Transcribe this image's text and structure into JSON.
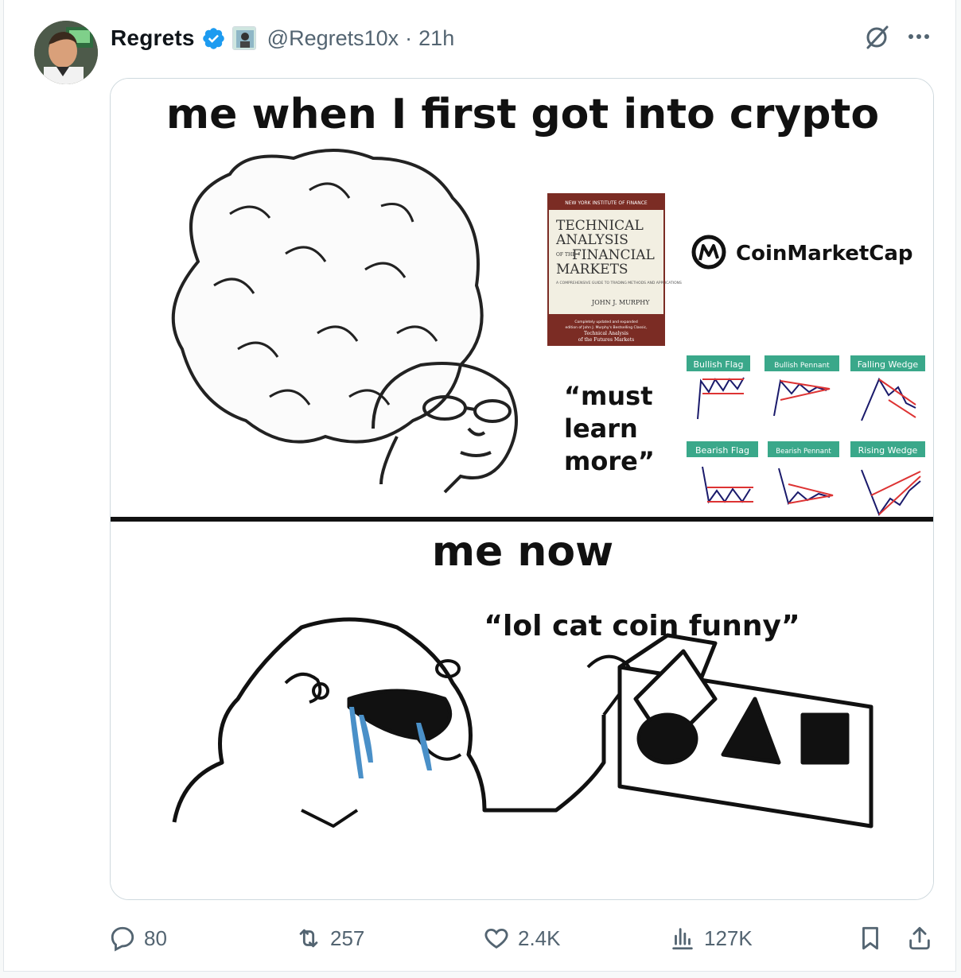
{
  "tweet": {
    "author_name": "Regrets",
    "handle": "@Regrets10x",
    "separator": "·",
    "time": "21h",
    "icons": {
      "verified": "verified-badge-icon",
      "affiliate": "affiliate-badge-icon",
      "grok": "grok-icon",
      "more": "more-icon"
    }
  },
  "meme": {
    "top_caption": "me when I first got into crypto",
    "book": {
      "publisher": "NEW YORK INSTITUTE OF FINANCE",
      "title_line1": "TECHNICAL",
      "title_line2": "ANALYSIS",
      "title_line3_small": "OF THE",
      "title_line3": "FINANCIAL",
      "title_line4": "MARKETS",
      "subtitle": "A COMPREHENSIVE GUIDE TO TRADING METHODS AND APPLICATIONS",
      "author": "JOHN J. MURPHY",
      "footer1": "Completely updated and expanded",
      "footer2": "edition of John J. Murphy's Bestselling Classic,",
      "footer3": "Technical Analysis",
      "footer4": "of the Futures Markets"
    },
    "coinmarketcap": "CoinMarketCap",
    "quote_line1": "“must",
    "quote_line2": "learn",
    "quote_line3": "more”",
    "patterns": [
      "Bullish Flag",
      "Bullish Pennant",
      "Falling Wedge",
      "Bearish Flag",
      "Bearish Pennant",
      "Rising Wedge"
    ],
    "bottom_caption": "me now",
    "bottom_quote": "“lol cat coin funny”",
    "colors": {
      "pattern_label_bg": "#3aa88a",
      "book_red": "#7b2c24",
      "cry_blue": "#4a90c8"
    }
  },
  "actions": {
    "replies": "80",
    "reposts": "257",
    "likes": "2.4K",
    "views": "127K",
    "icons": [
      "reply-icon",
      "repost-icon",
      "like-icon",
      "views-icon",
      "bookmark-icon",
      "share-icon"
    ]
  }
}
